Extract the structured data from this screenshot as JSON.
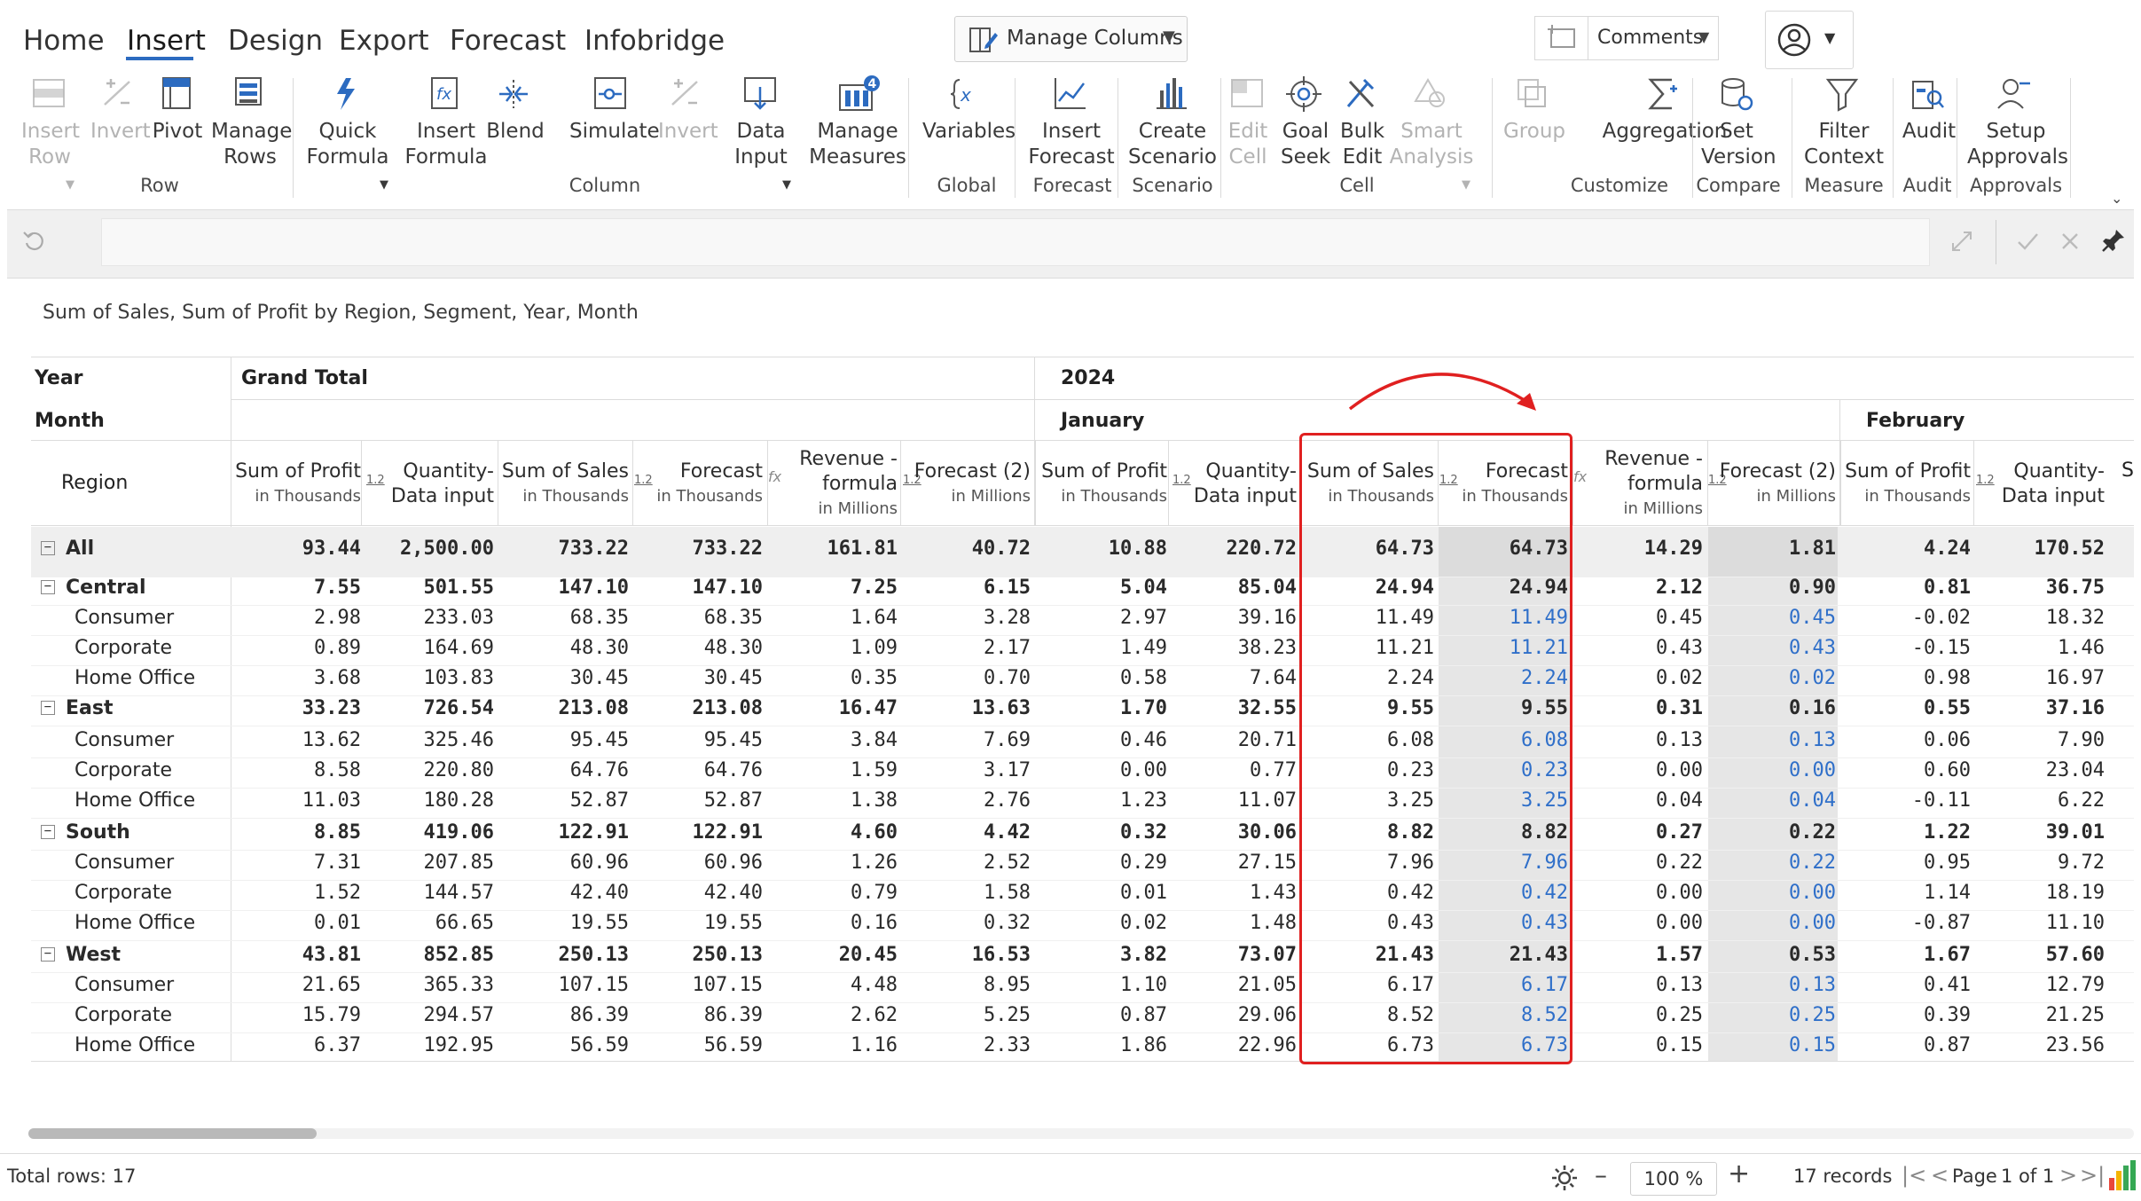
{
  "tabs": [
    "Home",
    "Insert",
    "Design",
    "Export",
    "Forecast",
    "Infobridge"
  ],
  "active_tab": "Insert",
  "manage_columns_label": "Manage Columns",
  "comments_label": "Comments",
  "ribbon": {
    "row": [
      {
        "l1": "Insert",
        "l2": "Row",
        "icon": "insert-row-icon",
        "disabled": true,
        "dropdown": true
      },
      {
        "l1": "Invert",
        "l2": "",
        "icon": "invert-icon",
        "disabled": true
      },
      {
        "l1": "Pivot",
        "l2": "",
        "icon": "pivot-icon",
        "disabled": false
      },
      {
        "l1": "Manage",
        "l2": "Rows",
        "icon": "manage-rows-icon",
        "disabled": false
      }
    ],
    "column": [
      {
        "l1": "Quick",
        "l2": "Formula",
        "icon": "quick-formula-icon",
        "disabled": false,
        "dropdown": true
      },
      {
        "l1": "Insert",
        "l2": "Formula",
        "icon": "insert-formula-icon",
        "disabled": false
      },
      {
        "l1": "Blend",
        "l2": "",
        "icon": "blend-icon",
        "disabled": false
      },
      {
        "l1": "Simulate",
        "l2": "",
        "icon": "simulate-icon",
        "disabled": false
      },
      {
        "l1": "Invert",
        "l2": "",
        "icon": "invert-icon",
        "disabled": true
      },
      {
        "l1": "Data",
        "l2": "Input",
        "icon": "data-input-icon",
        "disabled": false,
        "dropdown": true
      },
      {
        "l1": "Manage",
        "l2": "Measures",
        "icon": "manage-measures-icon",
        "disabled": false,
        "badge": "4"
      }
    ],
    "global": [
      {
        "l1": "Variables",
        "l2": "",
        "icon": "variables-icon",
        "disabled": false
      }
    ],
    "forecast": [
      {
        "l1": "Insert",
        "l2": "Forecast",
        "icon": "insert-forecast-icon",
        "disabled": false
      }
    ],
    "scenario": [
      {
        "l1": "Create",
        "l2": "Scenario",
        "icon": "create-scenario-icon",
        "disabled": false
      }
    ],
    "cell": [
      {
        "l1": "Edit",
        "l2": "Cell",
        "icon": "edit-cell-icon",
        "disabled": true
      },
      {
        "l1": "Goal",
        "l2": "Seek",
        "icon": "goal-seek-icon",
        "disabled": false
      },
      {
        "l1": "Bulk",
        "l2": "Edit",
        "icon": "bulk-edit-icon",
        "disabled": false
      },
      {
        "l1": "Smart",
        "l2": "Analysis",
        "icon": "smart-analysis-icon",
        "disabled": true,
        "dropdown": true
      }
    ],
    "customize": [
      {
        "l1": "Group",
        "l2": "",
        "icon": "group-icon",
        "disabled": true
      },
      {
        "l1": "Aggregation",
        "l2": "",
        "icon": "aggregation-icon",
        "disabled": false
      }
    ],
    "compare": [
      {
        "l1": "Set",
        "l2": "Version",
        "icon": "set-version-icon",
        "disabled": false
      }
    ],
    "measure": [
      {
        "l1": "Filter",
        "l2": "Context",
        "icon": "filter-context-icon",
        "disabled": false
      }
    ],
    "audit": [
      {
        "l1": "Audit",
        "l2": "",
        "icon": "audit-icon",
        "disabled": false
      }
    ],
    "approvals": [
      {
        "l1": "Setup",
        "l2": "Approvals",
        "icon": "setup-approvals-icon",
        "disabled": false
      }
    ],
    "group_labels": {
      "row": "Row",
      "column": "Column",
      "global": "Global",
      "forecast": "Forecast",
      "scenario": "Scenario",
      "cell": "Cell",
      "customize": "Customize",
      "compare": "Compare",
      "measure": "Measure",
      "audit": "Audit",
      "approvals": "Approvals"
    }
  },
  "grid": {
    "title": "Sum of Sales, Sum of Profit by Region, Segment, Year, Month",
    "year_label": "Year",
    "month_label": "Month",
    "region_label": "Region",
    "grand_total_label": "Grand Total",
    "year_value": "2024",
    "month_values": [
      "January",
      "February"
    ],
    "columns": [
      {
        "l1": "Sum of Profit",
        "l2": "in Thousands",
        "badge": "1.2"
      },
      {
        "l1": "Quantity-",
        "l2": "Data input",
        "badge": ""
      },
      {
        "l1": "Sum of Sales",
        "l2": "in Thousands",
        "badge": "1.2"
      },
      {
        "l1": "Forecast",
        "l2": "in Thousands",
        "badge": "fx"
      },
      {
        "l1": "Revenue -",
        "l1b": "formula",
        "l2": "in Millions",
        "badge": "1.2"
      },
      {
        "l1": "Forecast (2)",
        "l2": "in Millions",
        "badge": ""
      }
    ],
    "col_trunc": "S",
    "rows": [
      {
        "label": "All",
        "level": 0,
        "bold": true,
        "expand": true,
        "v": [
          "93.44",
          "2,500.00",
          "733.22",
          "733.22",
          "161.81",
          "40.72",
          "10.88",
          "220.72",
          "64.73",
          "64.73",
          "14.29",
          "1.81",
          "4.24",
          "170.52"
        ]
      },
      {
        "label": "Central",
        "level": 0,
        "bold": true,
        "expand": true,
        "v": [
          "7.55",
          "501.55",
          "147.10",
          "147.10",
          "7.25",
          "6.15",
          "5.04",
          "85.04",
          "24.94",
          "24.94",
          "2.12",
          "0.90",
          "0.81",
          "36.75"
        ]
      },
      {
        "label": "Consumer",
        "level": 1,
        "v": [
          "2.98",
          "233.03",
          "68.35",
          "68.35",
          "1.64",
          "3.28",
          "2.97",
          "39.16",
          "11.49",
          "11.49",
          "0.45",
          "0.45",
          "-0.02",
          "18.32"
        ]
      },
      {
        "label": "Corporate",
        "level": 1,
        "v": [
          "0.89",
          "164.69",
          "48.30",
          "48.30",
          "1.09",
          "2.17",
          "1.49",
          "38.23",
          "11.21",
          "11.21",
          "0.43",
          "0.43",
          "-0.15",
          "1.46"
        ]
      },
      {
        "label": "Home Office",
        "level": 1,
        "v": [
          "3.68",
          "103.83",
          "30.45",
          "30.45",
          "0.35",
          "0.70",
          "0.58",
          "7.64",
          "2.24",
          "2.24",
          "0.02",
          "0.02",
          "0.98",
          "16.97"
        ]
      },
      {
        "label": "East",
        "level": 0,
        "bold": true,
        "expand": true,
        "v": [
          "33.23",
          "726.54",
          "213.08",
          "213.08",
          "16.47",
          "13.63",
          "1.70",
          "32.55",
          "9.55",
          "9.55",
          "0.31",
          "0.16",
          "0.55",
          "37.16"
        ]
      },
      {
        "label": "Consumer",
        "level": 1,
        "v": [
          "13.62",
          "325.46",
          "95.45",
          "95.45",
          "3.84",
          "7.69",
          "0.46",
          "20.71",
          "6.08",
          "6.08",
          "0.13",
          "0.13",
          "0.06",
          "7.90"
        ]
      },
      {
        "label": "Corporate",
        "level": 1,
        "v": [
          "8.58",
          "220.80",
          "64.76",
          "64.76",
          "1.59",
          "3.17",
          "0.00",
          "0.77",
          "0.23",
          "0.23",
          "0.00",
          "0.00",
          "0.60",
          "23.04"
        ]
      },
      {
        "label": "Home Office",
        "level": 1,
        "v": [
          "11.03",
          "180.28",
          "52.87",
          "52.87",
          "1.38",
          "2.76",
          "1.23",
          "11.07",
          "3.25",
          "3.25",
          "0.04",
          "0.04",
          "-0.11",
          "6.22"
        ]
      },
      {
        "label": "South",
        "level": 0,
        "bold": true,
        "expand": true,
        "v": [
          "8.85",
          "419.06",
          "122.91",
          "122.91",
          "4.60",
          "4.42",
          "0.32",
          "30.06",
          "8.82",
          "8.82",
          "0.27",
          "0.22",
          "1.22",
          "39.01"
        ]
      },
      {
        "label": "Consumer",
        "level": 1,
        "v": [
          "7.31",
          "207.85",
          "60.96",
          "60.96",
          "1.26",
          "2.52",
          "0.29",
          "27.15",
          "7.96",
          "7.96",
          "0.22",
          "0.22",
          "0.95",
          "9.72"
        ]
      },
      {
        "label": "Corporate",
        "level": 1,
        "v": [
          "1.52",
          "144.57",
          "42.40",
          "42.40",
          "0.79",
          "1.58",
          "0.01",
          "1.43",
          "0.42",
          "0.42",
          "0.00",
          "0.00",
          "1.14",
          "18.19"
        ]
      },
      {
        "label": "Home Office",
        "level": 1,
        "v": [
          "0.01",
          "66.65",
          "19.55",
          "19.55",
          "0.16",
          "0.32",
          "0.02",
          "1.48",
          "0.43",
          "0.43",
          "0.00",
          "0.00",
          "-0.87",
          "11.10"
        ]
      },
      {
        "label": "West",
        "level": 0,
        "bold": true,
        "expand": true,
        "v": [
          "43.81",
          "852.85",
          "250.13",
          "250.13",
          "20.45",
          "16.53",
          "3.82",
          "73.07",
          "21.43",
          "21.43",
          "1.57",
          "0.53",
          "1.67",
          "57.60"
        ]
      },
      {
        "label": "Consumer",
        "level": 1,
        "v": [
          "21.65",
          "365.33",
          "107.15",
          "107.15",
          "4.48",
          "8.95",
          "1.10",
          "21.05",
          "6.17",
          "6.17",
          "0.13",
          "0.13",
          "0.41",
          "12.79"
        ]
      },
      {
        "label": "Corporate",
        "level": 1,
        "v": [
          "15.79",
          "294.57",
          "86.39",
          "86.39",
          "2.62",
          "5.25",
          "0.87",
          "29.06",
          "8.52",
          "8.52",
          "0.25",
          "0.25",
          "0.39",
          "21.25"
        ]
      },
      {
        "label": "Home Office",
        "level": 1,
        "v": [
          "6.37",
          "192.95",
          "56.59",
          "56.59",
          "1.16",
          "2.33",
          "1.86",
          "22.96",
          "6.73",
          "6.73",
          "0.15",
          "0.15",
          "0.87",
          "23.56"
        ]
      }
    ]
  },
  "status": {
    "total_rows": "Total rows: 17",
    "zoom": "100 %",
    "records": "17 records",
    "page_prefix": "Page",
    "page_current": "1",
    "page_of": "of 1"
  },
  "colors": {
    "accent": "#2c6bc0",
    "highlight_border": "#e02020",
    "editable_value": "#2f6fc9",
    "editable_bg": "#dcdcdc"
  }
}
